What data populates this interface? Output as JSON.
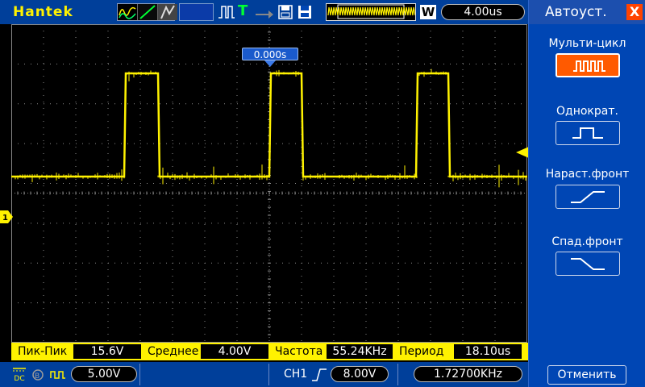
{
  "header": {
    "brand": "Hantek",
    "w_label": "W",
    "timebase": "4.00us",
    "trigger_mode_letter": "T"
  },
  "scope": {
    "trigger_time": "0.000s",
    "trace_color": "#fff200",
    "grid_color": "#8a8a8a"
  },
  "measurements": [
    {
      "label": "Пик-Пик",
      "value": "15.6V"
    },
    {
      "label": "Среднее",
      "value": "4.00V"
    },
    {
      "label": "Частота",
      "value": "55.24KHz"
    },
    {
      "label": "Период",
      "value": "18.10us"
    }
  ],
  "status": {
    "coupling": "DC",
    "ch1_volts": "5.00V",
    "trigger_source": "CH1",
    "trigger_level": "8.00V",
    "frequency": "1.72700KHz"
  },
  "panel": {
    "title": "Автоуст.",
    "close": "X",
    "options": [
      {
        "label": "Мульти-цикл",
        "icon": "multi-cycle-icon",
        "selected": true
      },
      {
        "label": "Однократ.",
        "icon": "single-pulse-icon",
        "selected": false
      },
      {
        "label": "Нараст.фронт",
        "icon": "rising-edge-icon",
        "selected": false
      },
      {
        "label": "Спад.фронт",
        "icon": "falling-edge-icon",
        "selected": false
      }
    ],
    "cancel": "Отменить"
  },
  "colors": {
    "bar_blue": "#003f9a",
    "panel_blue": "#0046b4",
    "accent_yellow": "#fff200",
    "selected_orange": "#ff5a00",
    "close_red": "#ff4300"
  }
}
